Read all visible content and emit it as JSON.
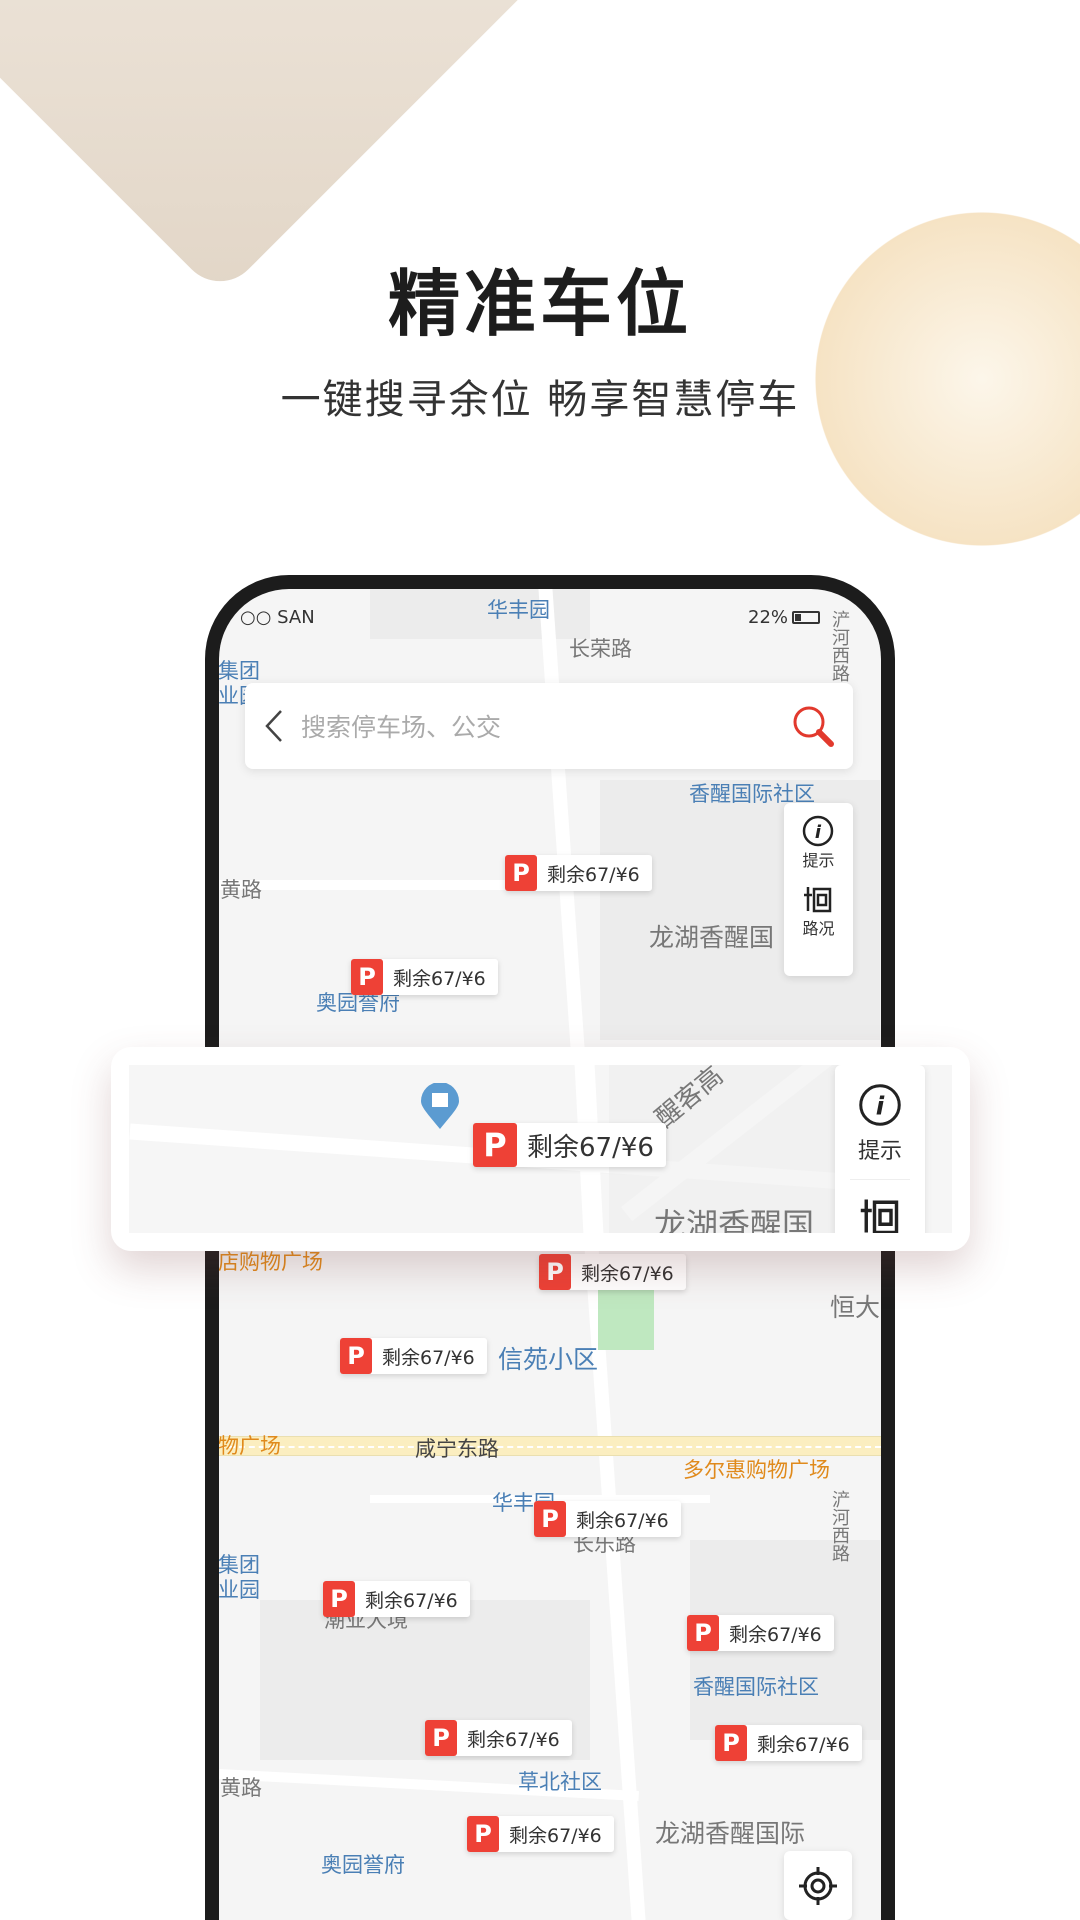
{
  "header": {
    "title": "精准车位",
    "subtitle": "一键搜寻余位 畅享智慧停车"
  },
  "status_bar": {
    "carrier": "○○ SAN",
    "battery": "22%"
  },
  "search": {
    "placeholder": "搜索停车场、公交",
    "back_icon": "chevron-left-icon",
    "search_icon": "search-icon"
  },
  "tools": {
    "tip_label": "提示",
    "traffic_label": "路况"
  },
  "marker": {
    "parking_glyph": "P",
    "text": "剩余67/¥6"
  },
  "map_labels": [
    "华丰园",
    "长荣路",
    "集团",
    "业园",
    "香醒国际社区",
    "黄路",
    "龙湖香醒国",
    "奥园誉府",
    "店购物广场",
    "信苑小区",
    "恒大",
    "物广场",
    "咸宁东路",
    "多尔惠购物广场",
    "华丰园",
    "长乐路",
    "集团",
    "业园",
    "潮业大境",
    "香醒国际社区",
    "黄路",
    "草北社区",
    "龙湖香醒国际",
    "奥园誉府",
    "浐河西路",
    "浐河西路"
  ],
  "popup": {
    "marker_text": "剩余67/¥6",
    "tip_label": "提示",
    "road_label": "龙湖香醒国",
    "road2": "醒客高"
  },
  "colors": {
    "accent": "#ee4136",
    "map_label_blue": "#4a7fb5",
    "poi_orange": "#e08a1c"
  }
}
